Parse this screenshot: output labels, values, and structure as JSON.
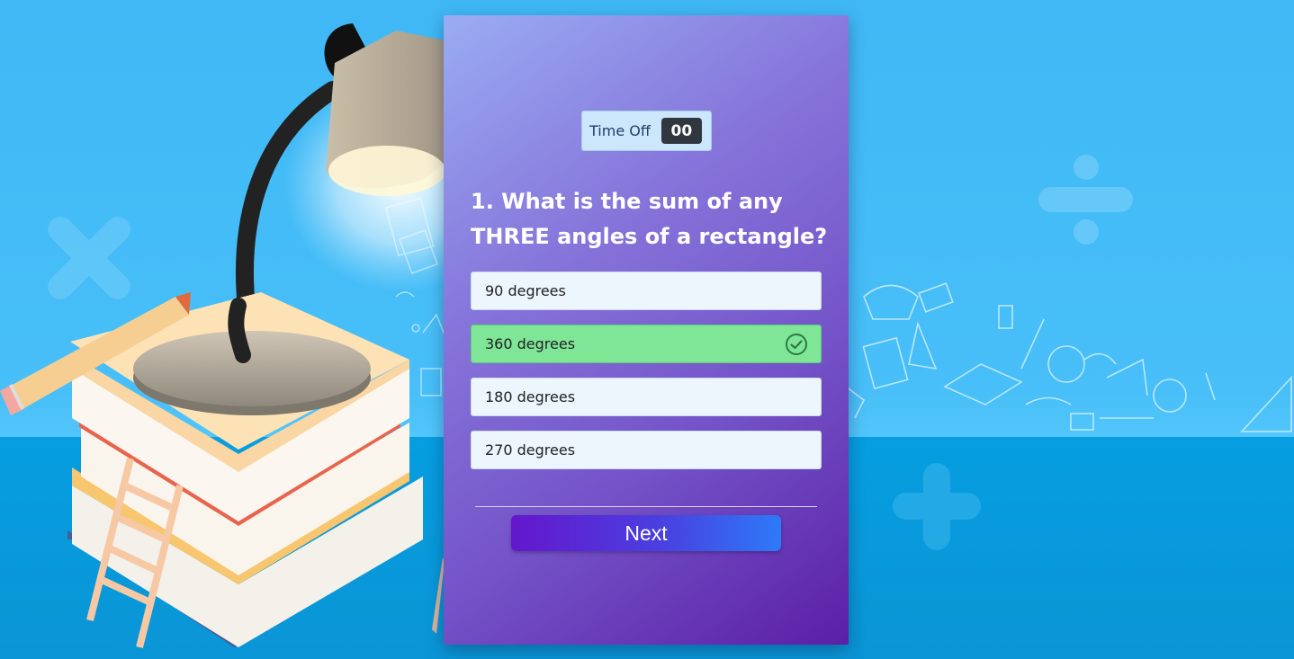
{
  "timer": {
    "label": "Time Off",
    "value": "00"
  },
  "question": {
    "text": "1. What is the sum of any THREE angles of a rectangle?"
  },
  "options": [
    {
      "label": "90 degrees",
      "state": "default"
    },
    {
      "label": "360 degrees",
      "state": "correct"
    },
    {
      "label": "180 degrees",
      "state": "default"
    },
    {
      "label": "270 degrees",
      "state": "default"
    }
  ],
  "next_button": {
    "label": "Next"
  },
  "colors": {
    "correct": "#7fe597",
    "option_bg": "#edf5fd",
    "card_top": "#9aacf3",
    "card_bottom": "#5b1fa6",
    "button_start": "#6417cc",
    "button_end": "#2d7af7"
  },
  "icons": {
    "correct_mark": "check-circle-icon"
  }
}
